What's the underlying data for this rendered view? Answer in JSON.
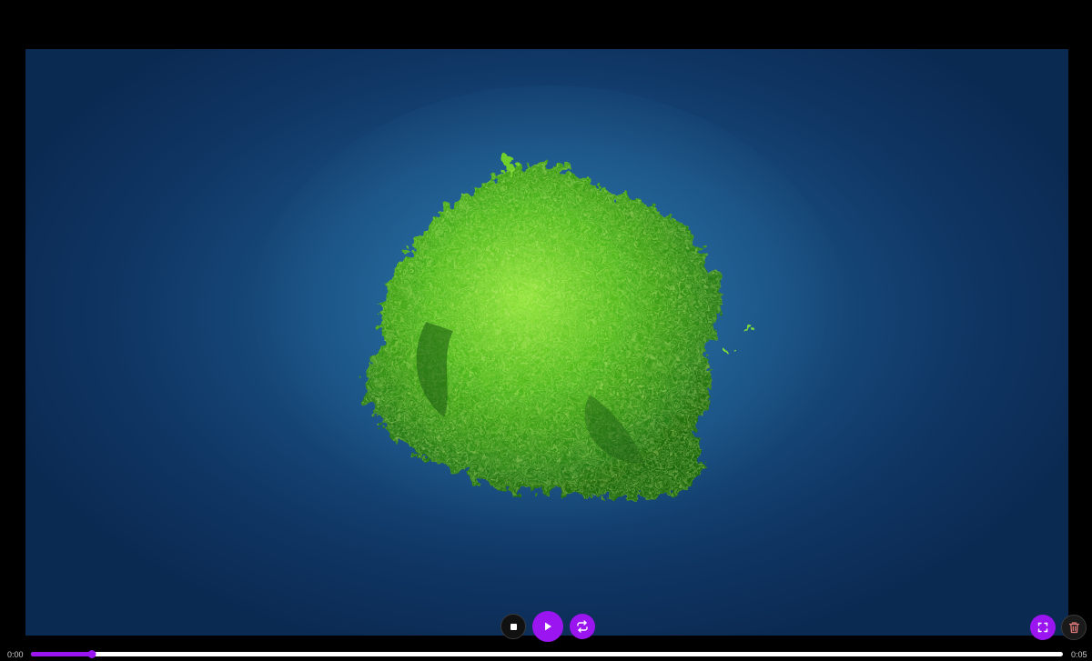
{
  "video": {
    "subject_icon": "green-particle-blob",
    "background_color": "#174b7c"
  },
  "controls": {
    "stop_icon": "stop-icon",
    "play_icon": "play-icon",
    "loop_icon": "loop-icon",
    "fullscreen_icon": "fullscreen-icon",
    "delete_icon": "trash-icon"
  },
  "playback": {
    "current_time": "0:00",
    "total_time": "0:05",
    "progress_fraction": 0.059
  },
  "colors": {
    "accent": "#9b15f0",
    "track": "#ffffff",
    "background": "#000000"
  }
}
